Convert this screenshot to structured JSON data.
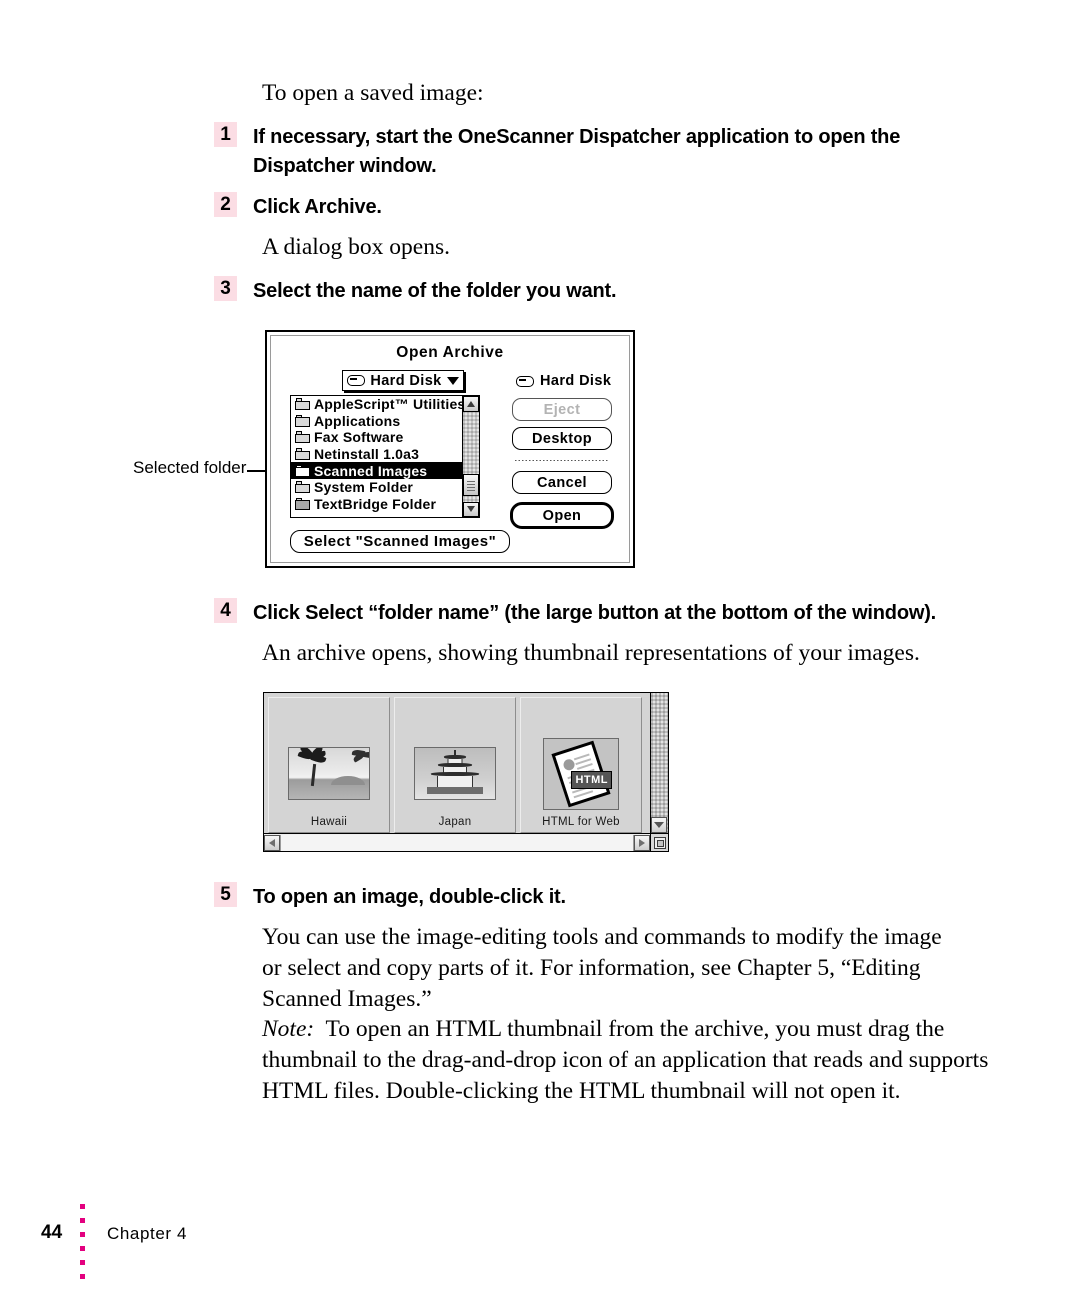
{
  "page": {
    "heading": "To open a saved image:",
    "after_step2_text": "A dialog box opens.",
    "after_step4_text": "An archive opens, showing thumbnail representations of your images.",
    "body_paragraph": "You can use the image-editing tools and commands to modify the image or select and copy parts of it. For information, see Chapter 5, “Editing Scanned Images.”",
    "note_label": "Note:",
    "note_text": "To open an HTML thumbnail from the archive, you must drag the thumbnail to the drag-and-drop icon of an application that reads and supports HTML files. Double-clicking the HTML thumbnail will not open it."
  },
  "steps": [
    {
      "num": "1",
      "text": "If necessary, start the OneScanner Dispatcher application to open the Dispatcher window."
    },
    {
      "num": "2",
      "text": "Click Archive."
    },
    {
      "num": "3",
      "text": "Select the name of the folder you want."
    },
    {
      "num": "4",
      "text": "Click Select “folder name” (the large button at the bottom of the window)."
    },
    {
      "num": "5",
      "text": "To open an image, double-click it."
    }
  ],
  "callout": {
    "label": "Selected folder"
  },
  "dialog": {
    "title": "Open Archive",
    "volume_popup": "Hard Disk",
    "volume_label": "Hard Disk",
    "items": [
      {
        "name": "AppleScript™ Utilities",
        "selected": false,
        "shaded": false
      },
      {
        "name": "Applications",
        "selected": false,
        "shaded": false
      },
      {
        "name": "Fax Software",
        "selected": false,
        "shaded": false
      },
      {
        "name": "Netinstall 1.0a3",
        "selected": false,
        "shaded": false
      },
      {
        "name": "Scanned Images",
        "selected": true,
        "shaded": false
      },
      {
        "name": "System Folder",
        "selected": false,
        "shaded": false
      },
      {
        "name": "TextBridge Folder",
        "selected": false,
        "shaded": true
      }
    ],
    "buttons": {
      "eject": "Eject",
      "desktop": "Desktop",
      "cancel": "Cancel",
      "open": "Open",
      "select": "Select \"Scanned Images\""
    }
  },
  "archive_window": {
    "thumbnails": [
      {
        "label": "Hawaii",
        "kind": "photo-beach"
      },
      {
        "label": "Japan",
        "kind": "photo-pagoda"
      },
      {
        "label": "HTML for Web",
        "kind": "html-doc"
      }
    ],
    "html_badge": "HTML"
  },
  "footer": {
    "page_number": "44",
    "chapter": "Chapter 4"
  },
  "colors": {
    "step_badge_bg": "#fbdde4",
    "footer_dot": "#e3007f"
  }
}
